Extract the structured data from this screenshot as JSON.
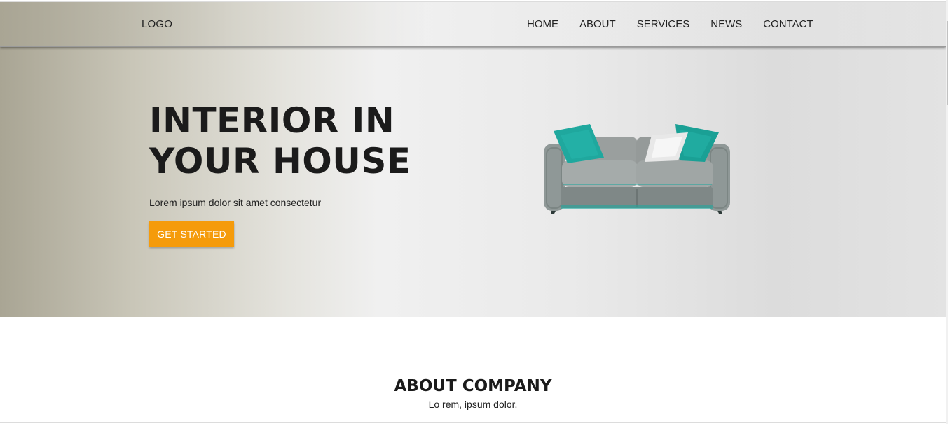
{
  "header": {
    "logo": "LOGO",
    "nav": [
      "HOME",
      "ABOUT",
      "SERVICES",
      "NEWS",
      "CONTACT"
    ]
  },
  "hero": {
    "title_line1": "INTERIOR IN",
    "title_line2": "YOUR HOUSE",
    "subtitle": "Lorem ipsum dolor sit amet consectetur",
    "cta_label": "GET STARTED",
    "image_name": "sofa-image"
  },
  "about": {
    "title": "ABOUT COMPANY",
    "subtitle": "Lo rem, ipsum dolor."
  },
  "colors": {
    "accent": "#f59b0b",
    "pillow": "#1fa89e",
    "sofa": "#9da3a1"
  }
}
